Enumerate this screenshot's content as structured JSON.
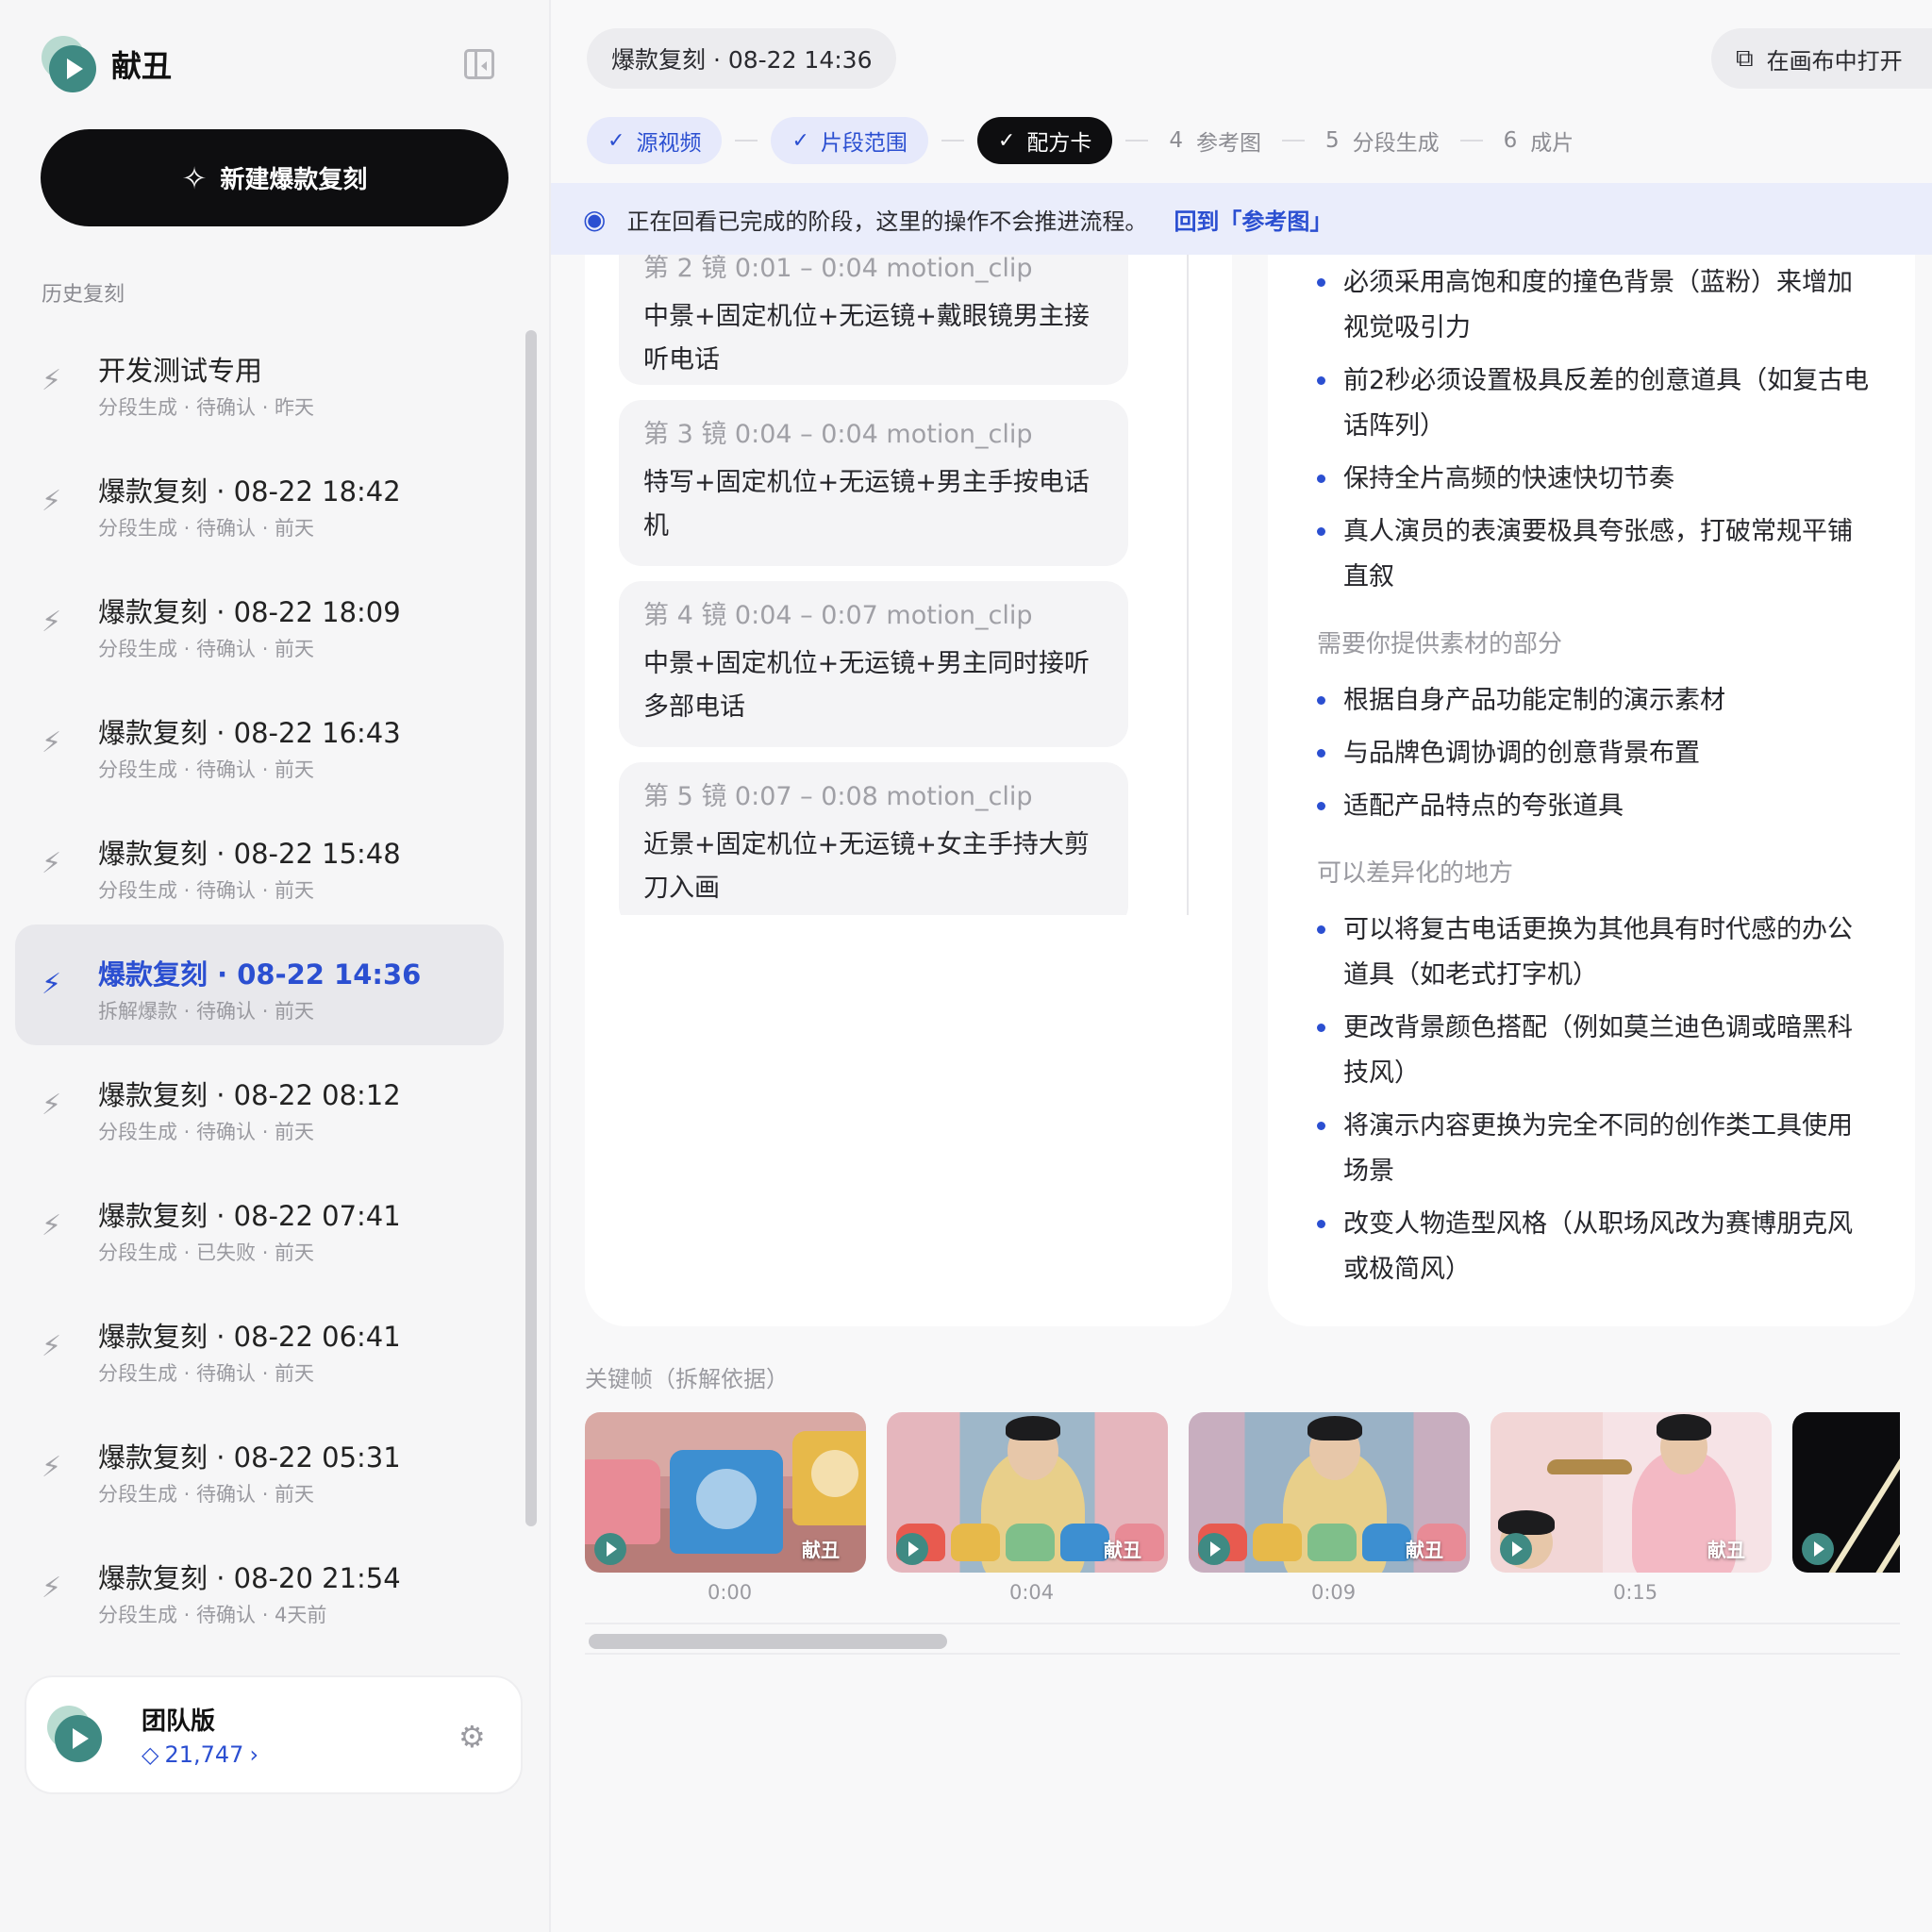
{
  "app": {
    "name": "献丑",
    "new_button": "新建爆款复刻",
    "history_title": "历史复刻"
  },
  "history": [
    {
      "title": "开发测试专用",
      "meta": "分段生成 · 待确认 · 昨天",
      "active": false
    },
    {
      "title": "爆款复刻 · 08-22 18:42",
      "meta": "分段生成 · 待确认 · 前天",
      "active": false
    },
    {
      "title": "爆款复刻 · 08-22 18:09",
      "meta": "分段生成 · 待确认 · 前天",
      "active": false
    },
    {
      "title": "爆款复刻 · 08-22 16:43",
      "meta": "分段生成 · 待确认 · 前天",
      "active": false
    },
    {
      "title": "爆款复刻 · 08-22 15:48",
      "meta": "分段生成 · 待确认 · 前天",
      "active": false
    },
    {
      "title": "爆款复刻 · 08-22 14:36",
      "meta": "拆解爆款 · 待确认 · 前天",
      "active": true
    },
    {
      "title": "爆款复刻 · 08-22 08:12",
      "meta": "分段生成 · 待确认 · 前天",
      "active": false
    },
    {
      "title": "爆款复刻 · 08-22 07:41",
      "meta": "分段生成 · 已失败 · 前天",
      "active": false
    },
    {
      "title": "爆款复刻 · 08-22 06:41",
      "meta": "分段生成 · 待确认 · 前天",
      "active": false
    },
    {
      "title": "爆款复刻 · 08-22 05:31",
      "meta": "分段生成 · 待确认 · 前天",
      "active": false
    },
    {
      "title": "爆款复刻 · 08-20 21:54",
      "meta": "分段生成 · 待确认 · 4天前",
      "active": false
    }
  ],
  "team": {
    "plan": "团队版",
    "credits": "21,747",
    "credit_icon": "diamond-icon",
    "settings_icon": "gear-icon"
  },
  "header": {
    "session": "爆款复刻 · 08-22 14:36",
    "open_canvas": "在画布中打开"
  },
  "steps": [
    {
      "label": "源视频",
      "state": "done"
    },
    {
      "label": "片段范围",
      "state": "done"
    },
    {
      "label": "配方卡",
      "state": "current"
    },
    {
      "num": "4",
      "label": "参考图",
      "state": "todo"
    },
    {
      "num": "5",
      "label": "分段生成",
      "state": "todo"
    },
    {
      "num": "6",
      "label": "成片",
      "state": "todo"
    }
  ],
  "notice": {
    "text": "正在回看已完成的阶段，这里的操作不会推进流程。",
    "link": "回到「参考图」"
  },
  "shots": [
    {
      "head": "第 2 镜   0:01 – 0:04   motion_clip",
      "body": "中景+固定机位+无运镜+戴眼镜男主接听电话"
    },
    {
      "head": "第 3 镜   0:04 – 0:04   motion_clip",
      "body": "特写+固定机位+无运镜+男主手按电话机"
    },
    {
      "head": "第 4 镜   0:04 – 0:07   motion_clip",
      "body": "中景+固定机位+无运镜+男主同时接听多部电话"
    },
    {
      "head": "第 5 镜   0:07 – 0:08   motion_clip",
      "body": "近景+固定机位+无运镜+女主手持大剪刀入画"
    }
  ],
  "recipe": {
    "bullets_top": [
      "必须采用高饱和度的撞色背景（蓝粉）来增加视觉吸引力",
      "前2秒必须设置极具反差的创意道具（如复古电话阵列）",
      "保持全片高频的快速快切节奏",
      "真人演员的表演要极具夸张感，打破常规平铺直叙"
    ],
    "section_provide": "需要你提供素材的部分",
    "bullets_provide": [
      "根据自身产品功能定制的演示素材",
      "与品牌色调协调的创意背景布置",
      "适配产品特点的夸张道具"
    ],
    "section_diff": "可以差异化的地方",
    "bullets_diff": [
      "可以将复古电话更换为其他具有时代感的办公道具（如老式打字机）",
      "更改背景颜色搭配（例如莫兰迪色调或暗黑科技风）",
      "将演示内容更换为完全不同的创作类工具使用场景",
      "改变人物造型风格（从职场风改为赛博朋克风或极简风）"
    ]
  },
  "keyframes": {
    "title": "关键帧（拆解依据）",
    "items": [
      {
        "time": "0:00",
        "watermark": "献丑"
      },
      {
        "time": "0:04",
        "watermark": "献丑"
      },
      {
        "time": "0:09",
        "watermark": "献丑"
      },
      {
        "time": "0:15",
        "watermark": "献丑"
      },
      {
        "time": "",
        "watermark": ""
      }
    ]
  }
}
